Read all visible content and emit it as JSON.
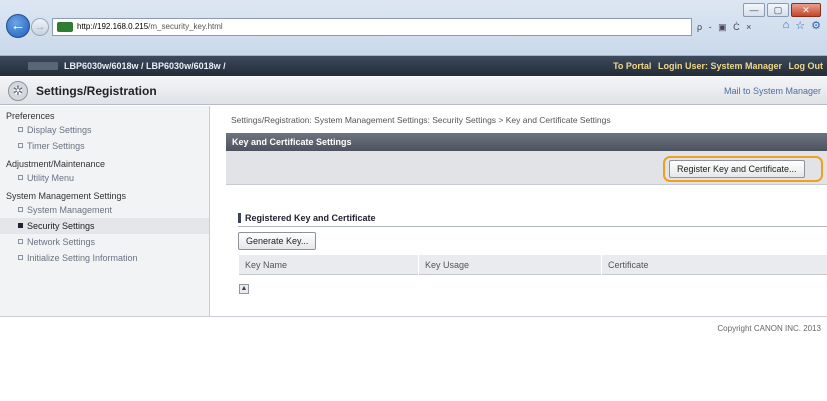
{
  "browser": {
    "url_host": "http://192.168.0.215",
    "url_path": "/m_security_key.html",
    "addr_tools": "ρ - ▣ Ċ ×",
    "win_min": "—",
    "win_max": "▢",
    "win_close": "✕"
  },
  "device_bar": {
    "model": "LBP6030w/6018w / LBP6030w/6018w /",
    "to_portal": "To Portal",
    "login_user": "Login User: System Manager",
    "logout": "Log Out"
  },
  "header": {
    "title": "Settings/Registration",
    "mail_link": "Mail to System Manager"
  },
  "sidebar": {
    "groups": [
      {
        "heading": "Preferences",
        "items": [
          "Display Settings",
          "Timer Settings"
        ]
      },
      {
        "heading": "Adjustment/Maintenance",
        "items": [
          "Utility Menu"
        ]
      },
      {
        "heading": "System Management Settings",
        "items": [
          "System Management",
          "Security Settings",
          "Network Settings",
          "Initialize Setting Information"
        ]
      }
    ],
    "active_item": "Security Settings"
  },
  "main": {
    "breadcrumb": "Settings/Registration: System Management Settings: Security Settings > Key and Certificate Settings",
    "section_title": "Key and Certificate Settings",
    "register_button": "Register Key and Certificate...",
    "subsection_title": "Registered Key and Certificate",
    "generate_button": "Generate Key...",
    "table_columns": [
      "Key Name",
      "Key Usage",
      "Certificate"
    ],
    "scroll_top_icon": "▲"
  },
  "footer": {
    "copyright": "Copyright CANON INC. 2013"
  },
  "colors": {
    "highlight": "#f0a01e",
    "devbar": "#2d3643",
    "section_header": "#5b616c"
  }
}
